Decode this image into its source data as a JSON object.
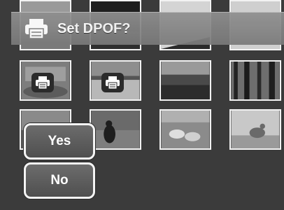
{
  "dialog": {
    "title": "Set DPOF?",
    "icon": "printer-icon",
    "options": [
      "Yes",
      "No"
    ]
  },
  "grid": {
    "rows": 3,
    "columns": 4,
    "dpof_marked": [
      0,
      1
    ]
  },
  "colors": {
    "background": "#3b3b3b",
    "banner": "#858585",
    "button_border": "#f4f4f4",
    "text": "#ffffff"
  }
}
